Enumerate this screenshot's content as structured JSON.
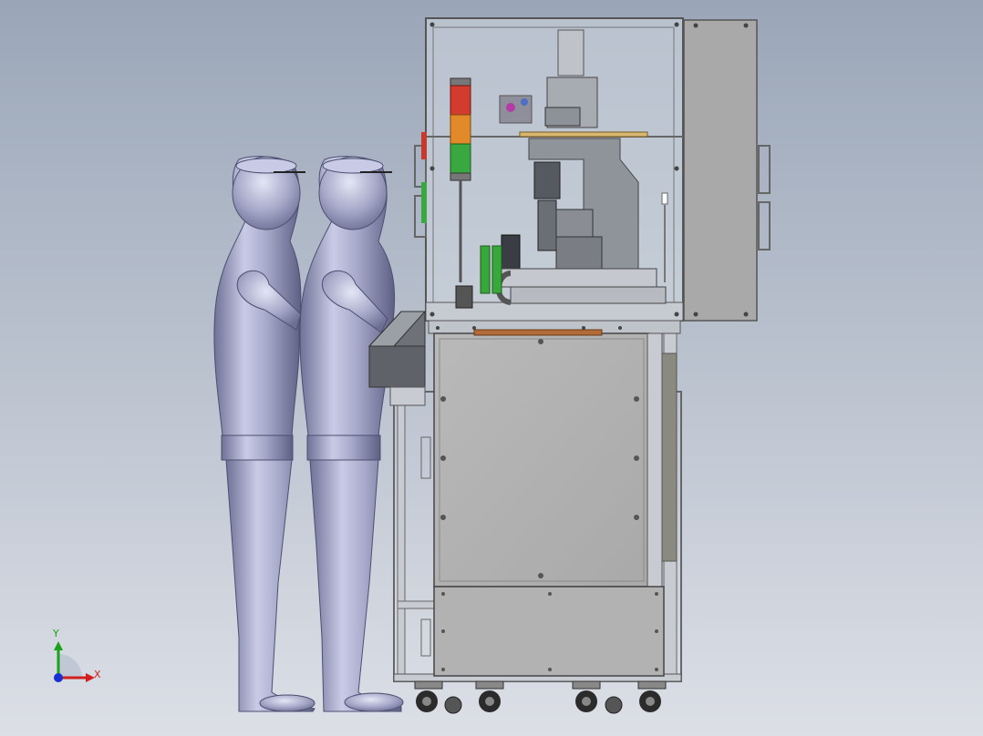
{
  "viewport": {
    "background_top": "#9aa6b8",
    "background_bottom": "#d9dde4"
  },
  "model": {
    "figures": [
      "operator-figure-left",
      "operator-figure-right"
    ],
    "machine": {
      "upper_enclosure": "frame-with-transparent-panels",
      "stack_light": [
        "red",
        "orange",
        "green"
      ],
      "lower_cabinet": "sheet-metal-cabinet",
      "casters": 4,
      "control_panel": "angled-hmi-console"
    }
  },
  "triad": {
    "x_label": "X",
    "y_label": "Y",
    "x_color": "#d21e1e",
    "y_color": "#1aa21a",
    "z_color": "#1a2fd2"
  }
}
